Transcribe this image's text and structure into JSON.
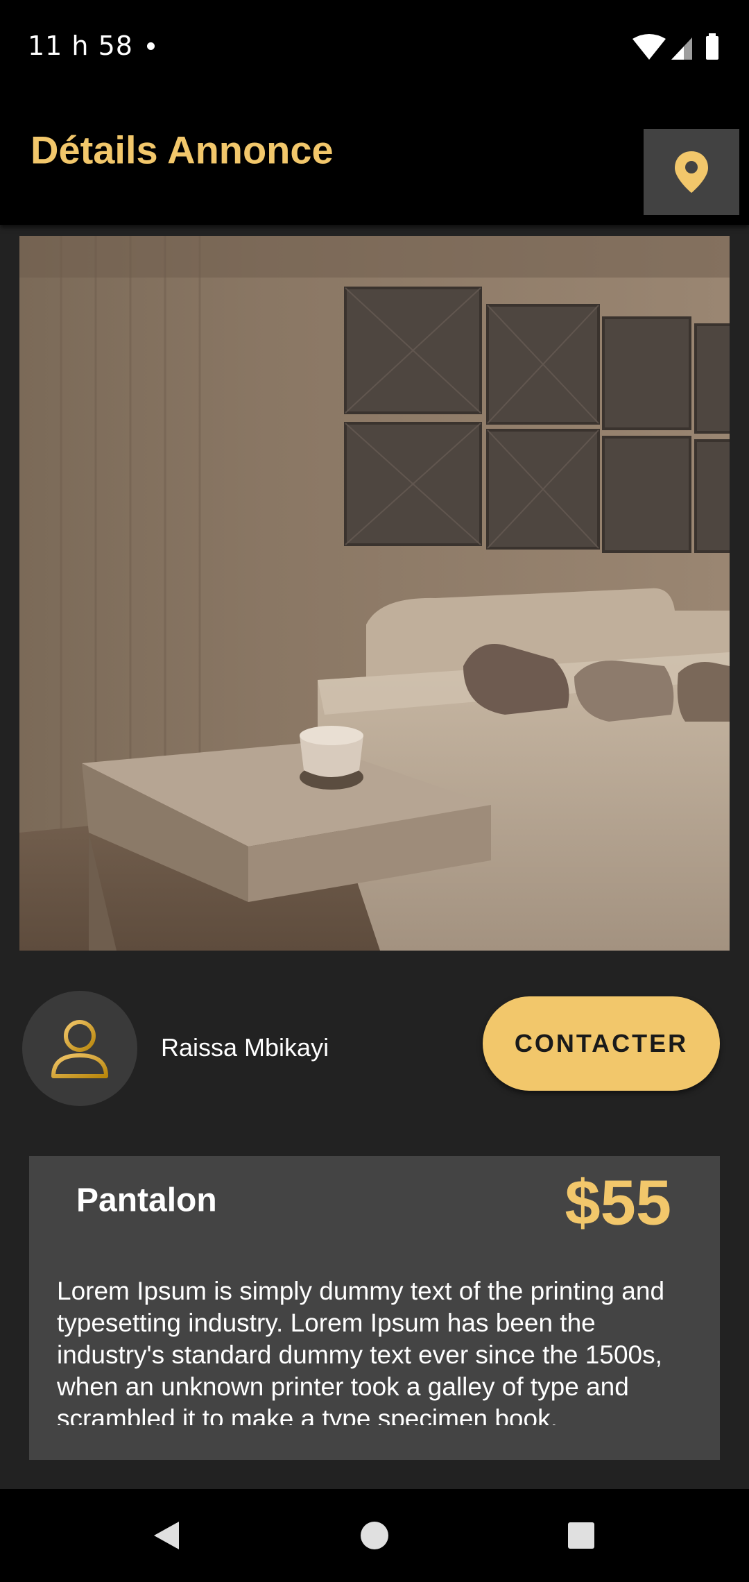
{
  "status_bar": {
    "time": "11 h 58",
    "icons": [
      "notification-dot-icon",
      "wifi-icon",
      "signal-icon",
      "battery-icon"
    ]
  },
  "app_bar": {
    "title": "Détails Annonce",
    "location_icon": "location-pin-icon"
  },
  "listing": {
    "seller_name": "Raissa Mbikayi",
    "contact_label": "CONTACTER",
    "title": "Pantalon",
    "price": "$55",
    "description": "Lorem Ipsum is simply dummy text of the printing and typesetting industry. Lorem Ipsum has been the industry's standard dummy text ever since the 1500s, when an unknown printer took a galley of type and scrambled it to make a type specimen book."
  },
  "colors": {
    "accent": "#F2C76B",
    "background": "#222222",
    "card": "#444444",
    "bar": "#000000"
  },
  "nav_bar": {
    "icons": [
      "back-icon",
      "home-icon",
      "recents-icon"
    ]
  }
}
